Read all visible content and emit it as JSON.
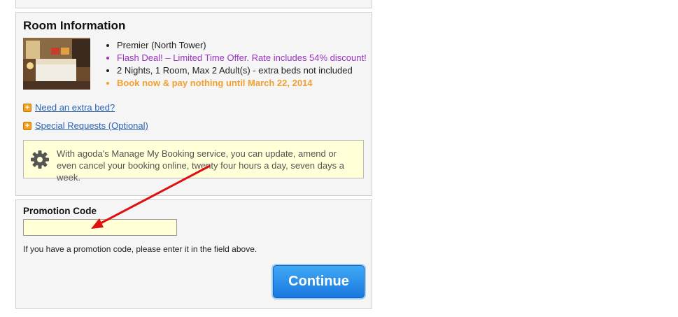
{
  "room": {
    "title": "Room Information",
    "photo_alt": "hotel room photo",
    "details": [
      "Premier (North Tower)",
      "Flash Deal! – Limited Time Offer. Rate includes 54% discount!",
      "2 Nights, 1 Room, Max 2 Adult(s) - extra beds not included",
      "Book now & pay nothing until March 22, 2014"
    ],
    "extra_bed_link": "Need an extra bed?",
    "special_requests_link": "Special Requests (Optional)",
    "manage_booking_info": "With agoda's Manage My Booking service, you can update, amend or even cancel your booking online, twenty four hours a day, seven days a week."
  },
  "promo": {
    "label": "Promotion Code",
    "input_value": "",
    "hint": "If you have a promotion code, please enter it in the field above.",
    "continue_label": "Continue"
  },
  "colors": {
    "flash_deal": "#9b30c4",
    "pay_later": "#f0a030",
    "link": "#2b63b5",
    "button": "#1a78e0",
    "annotation_arrow": "#e01010"
  }
}
